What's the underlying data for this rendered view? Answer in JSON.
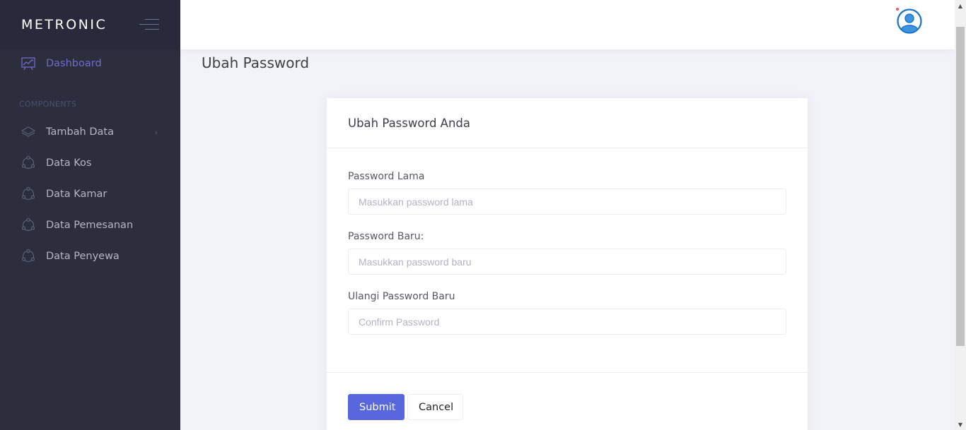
{
  "brand": {
    "name": "METRONIC"
  },
  "sidebar": {
    "section_title": "COMPONENTS",
    "dashboard_label": "Dashboard",
    "items": [
      {
        "label": "Tambah Data",
        "icon": "layers-icon",
        "has_submenu": true
      },
      {
        "label": "Data Kos",
        "icon": "circle-dots-icon"
      },
      {
        "label": "Data Kamar",
        "icon": "circle-dots-icon"
      },
      {
        "label": "Data Pemesanan",
        "icon": "circle-dots-icon"
      },
      {
        "label": "Data Penyewa",
        "icon": "circle-dots-icon"
      }
    ],
    "submenu_arrow": "›"
  },
  "header": {
    "avatar_icon": "user-avatar-icon"
  },
  "page": {
    "title": "Ubah Password"
  },
  "form": {
    "card_title": "Ubah Password Anda",
    "old_password": {
      "label": "Password Lama",
      "placeholder": "Masukkan password lama"
    },
    "new_password": {
      "label": "Password Baru:",
      "placeholder": "Masukkan password baru"
    },
    "confirm_password": {
      "label": "Ulangi Password Baru",
      "placeholder": "Confirm Password"
    },
    "submit_label": "Submit",
    "cancel_label": "Cancel"
  },
  "colors": {
    "sidebar_bg": "#2c2e3e",
    "brand_bg": "#282a3c",
    "accent": "#716aca",
    "primary_button": "#5867dd",
    "page_bg": "#f2f3f8"
  }
}
